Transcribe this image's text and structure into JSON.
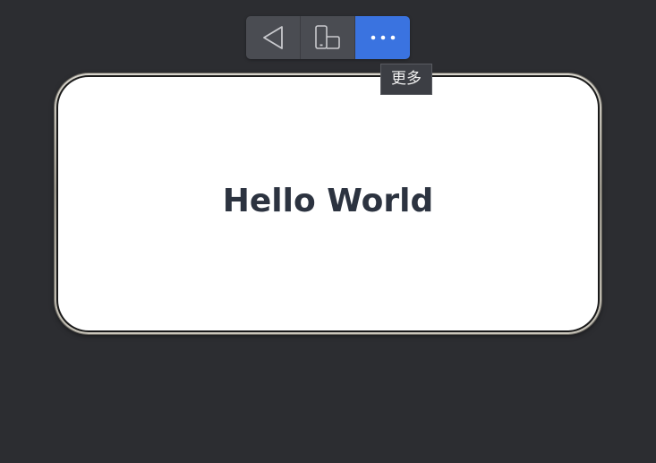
{
  "toolbar": {
    "buttons": [
      {
        "icon": "back-triangle-icon"
      },
      {
        "icon": "device-rotate-icon"
      },
      {
        "icon": "more-dots-icon",
        "active": true
      }
    ],
    "tooltip": "更多"
  },
  "screen": {
    "text": "Hello World"
  },
  "colors": {
    "background": "#2c2d31",
    "button": "#4a4c52",
    "active_button": "#3a73e0",
    "screen": "#ffffff",
    "text": "#2c3340"
  }
}
